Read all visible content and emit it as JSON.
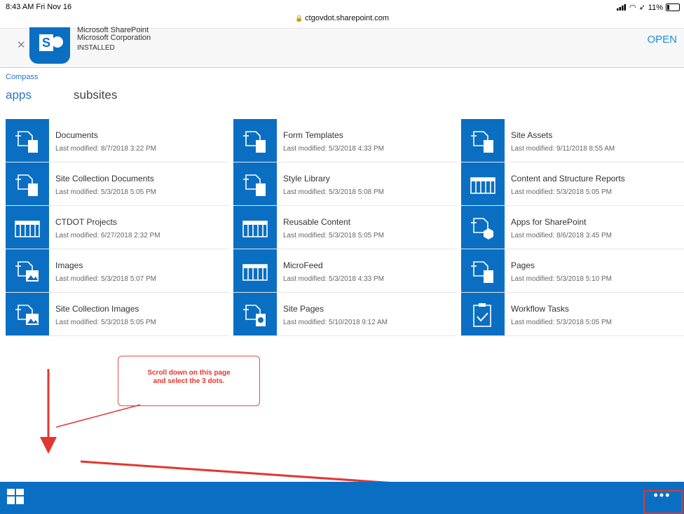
{
  "status": {
    "time": "8:43 AM  Fri Nov 16",
    "url": "ctgovdot.sharepoint.com",
    "battery": "11%"
  },
  "banner": {
    "app_name": "Microsoft SharePoint",
    "publisher": "Microsoft Corporation",
    "installed": "INSTALLED",
    "open_label": "OPEN"
  },
  "breadcrumb": "Compass",
  "tabs": {
    "apps": "apps",
    "subsites": "subsites"
  },
  "tiles": [
    {
      "name": "Documents",
      "modified": "Last modified: 8/7/2018 3:22 PM",
      "icon": "folder-icon"
    },
    {
      "name": "Form Templates",
      "modified": "Last modified: 5/3/2018 4:33 PM",
      "icon": "folder-icon"
    },
    {
      "name": "Site Assets",
      "modified": "Last modified: 9/11/2018 8:55 AM",
      "icon": "folder-icon"
    },
    {
      "name": "Site Collection Documents",
      "modified": "Last modified: 5/3/2018 5:05 PM",
      "icon": "folder-icon"
    },
    {
      "name": "Style Library",
      "modified": "Last modified: 5/3/2018 5:08 PM",
      "icon": "folder-icon"
    },
    {
      "name": "Content and Structure Reports",
      "modified": "Last modified: 5/3/2018 5:05 PM",
      "icon": "list-icon"
    },
    {
      "name": "CTDOT Projects",
      "modified": "Last modified: 6/27/2018 2:32 PM",
      "icon": "list-icon"
    },
    {
      "name": "Reusable Content",
      "modified": "Last modified: 5/3/2018 5:05 PM",
      "icon": "list-icon"
    },
    {
      "name": "Apps for SharePoint",
      "modified": "Last modified: 8/6/2018 3:45 PM",
      "icon": "app-folder-icon"
    },
    {
      "name": "Images",
      "modified": "Last modified: 5/3/2018 5:07 PM",
      "icon": "image-library-icon"
    },
    {
      "name": "MicroFeed",
      "modified": "Last modified: 5/3/2018 4:33 PM",
      "icon": "list-icon"
    },
    {
      "name": "Pages",
      "modified": "Last modified: 5/3/2018 5:10 PM",
      "icon": "folder-icon"
    },
    {
      "name": "Site Collection Images",
      "modified": "Last modified: 5/3/2018 5:05 PM",
      "icon": "image-library-icon"
    },
    {
      "name": "Site Pages",
      "modified": "Last modified: 5/10/2018 9:12 AM",
      "icon": "site-pages-icon"
    },
    {
      "name": "Workflow Tasks",
      "modified": "Last modified: 5/3/2018 5:05 PM",
      "icon": "task-list-icon"
    }
  ],
  "callout": {
    "line1": "Scroll down on this page",
    "line2": "and select the 3 dots."
  },
  "bottombar": {
    "more_label": "•••"
  },
  "colors": {
    "accent": "#0a6fc2",
    "annotation": "#e5352f"
  }
}
